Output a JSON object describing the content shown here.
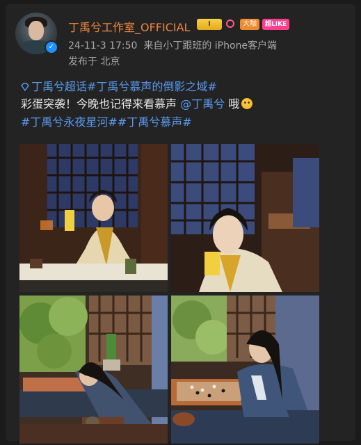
{
  "post": {
    "author": "丁禹兮工作室_OFFICIAL",
    "badges": {
      "level": "I",
      "big_fan": "大咖",
      "like": "超LIKE"
    },
    "verified_mark": "✓",
    "timestamp": "24-11-3 17:50",
    "source": "来自小丁跟班的 iPhone客户端",
    "location": "发布于 北京",
    "topic_1": "丁禹兮超话",
    "topic_2": "#丁禹兮慕声的倒影之域#",
    "body_prefix": "彩蛋突袭！今晚也记得来看慕声 ",
    "mention": "@丁禹兮",
    "body_suffix": " 哦",
    "topics_line": "#丁禹兮永夜星河##丁禹兮慕声#",
    "icons": {
      "supertopic": "diamond-icon",
      "emoji": "surprised-face-emoji-icon",
      "verified": "verified-check-icon"
    },
    "colors": {
      "username": "#f0873d",
      "link": "#5a9bf0",
      "meta": "#a8a8a8",
      "background": "#232323"
    }
  }
}
